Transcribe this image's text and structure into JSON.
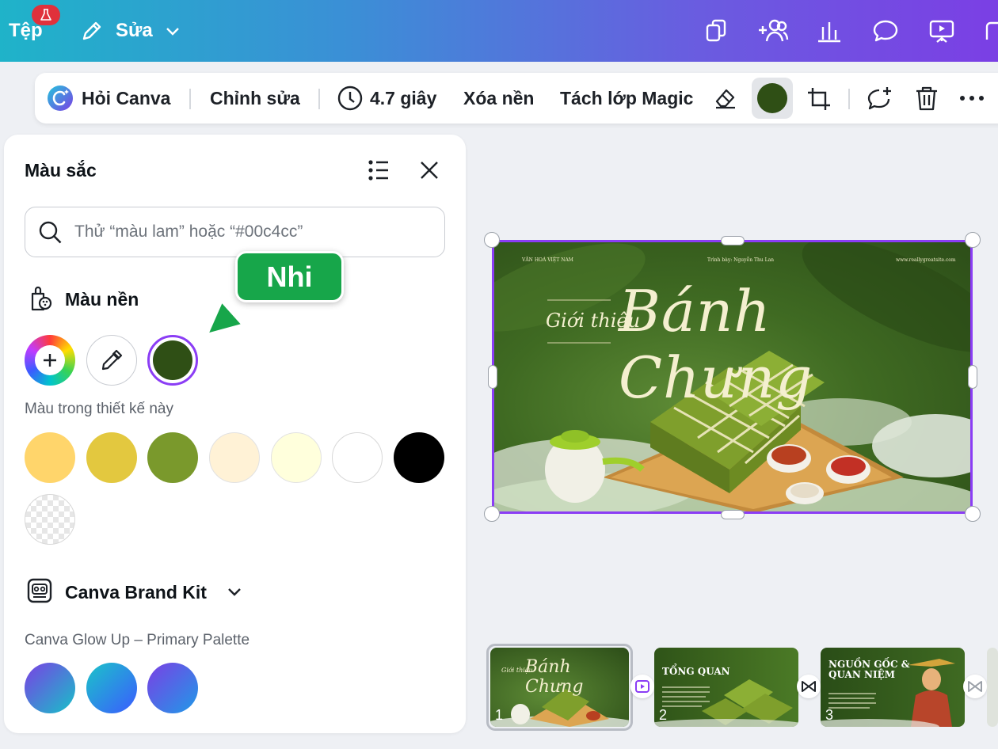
{
  "topbar": {
    "file_label": "Tệp",
    "edit_label": "Sửa"
  },
  "toolbar": {
    "ask_canva": "Hỏi Canva",
    "edit": "Chỉnh sửa",
    "duration": "4.7 giây",
    "remove_bg": "Xóa nền",
    "magic_layer": "Tách lớp Magic",
    "current_color": "#2f4f15"
  },
  "color_panel": {
    "title": "Màu sắc",
    "search": {
      "placeholder": "Thử “màu lam” hoặc “#00c4cc”"
    },
    "background_section": "Màu nền",
    "selected_color": "#2f4f15",
    "design_colors_label": "Màu trong thiết kế này",
    "design_colors": [
      "#ffd56b",
      "#e3c83f",
      "#7a992c",
      "#fff2d6",
      "#ffffdc",
      "#ffffff",
      "#000000",
      "transparent"
    ],
    "brand_kit_title": "Canva Brand Kit",
    "palette_name": "Canva Glow Up – Primary Palette",
    "palette_colors": [
      "purple-to-teal",
      "teal-to-blue",
      "violet-to-blue"
    ]
  },
  "tooltip": {
    "user": "Nhi"
  },
  "slide": {
    "top_left": "VĂN HOÁ VIỆT NAM",
    "top_center": "Trình bày: Nguyễn Thu Lan",
    "top_right": "www.reallygreatsite.com",
    "subtitle": "Giới thiệu",
    "title": "Bánh Chưng"
  },
  "thumbnails": [
    {
      "num": "1",
      "sub": "Giới thiệu",
      "title": "Bánh Chưng"
    },
    {
      "num": "2",
      "title": "TỔNG QUAN"
    },
    {
      "num": "3",
      "title": "NGUỒN GỐC & QUAN NIỆM"
    }
  ]
}
